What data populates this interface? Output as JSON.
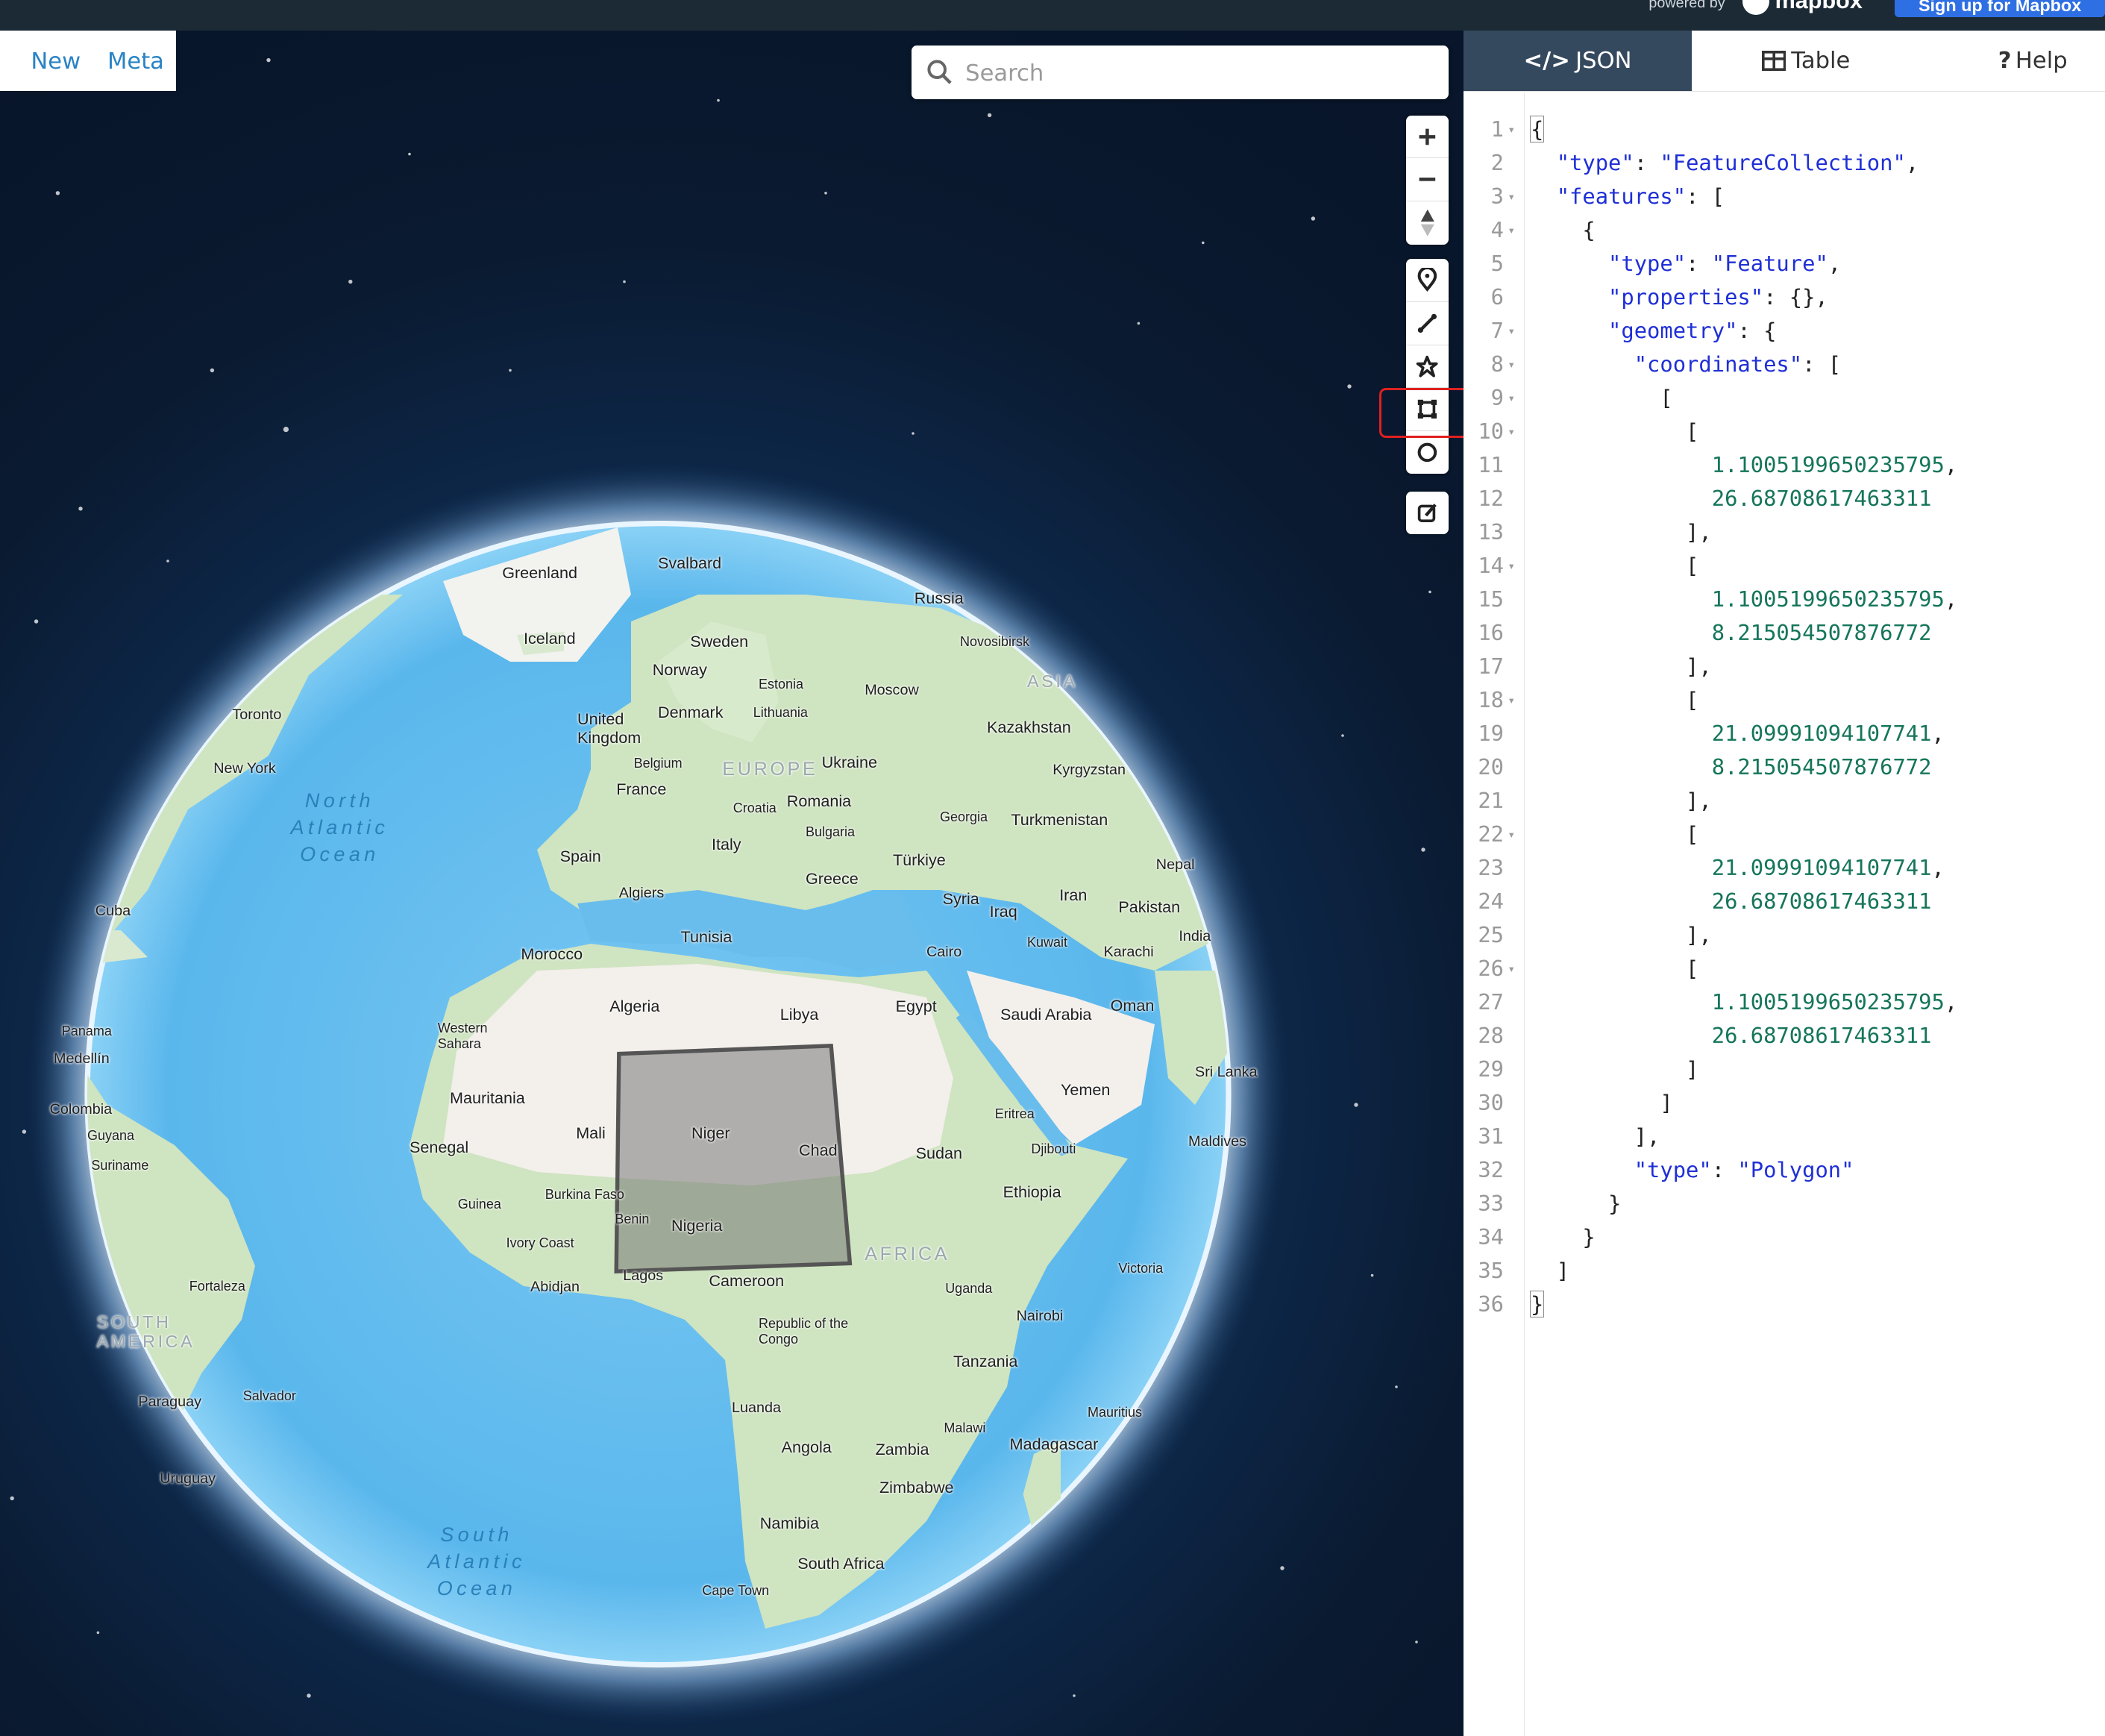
{
  "topbar": {
    "powered_by": "powered by",
    "mapbox": "mapbox",
    "signup": "Sign up for Mapbox"
  },
  "menu": {
    "new": "New",
    "meta": "Meta"
  },
  "search": {
    "placeholder": "Search"
  },
  "controls": [
    "plus-icon",
    "minus-icon",
    "compass-icon",
    "marker-icon",
    "line-icon",
    "polygon-icon",
    "rectangle-icon",
    "circle-icon",
    "edit-icon"
  ],
  "tabs": {
    "json": "JSON",
    "table": "Table",
    "help": "Help"
  },
  "map_labels": {
    "countries": [
      "Greenland",
      "Svalbard",
      "Russia",
      "Iceland",
      "Sweden",
      "Norway",
      "Estonia",
      "Moscow",
      "Novosibirsk",
      "ASIA",
      "Toronto",
      "New York",
      "United Kingdom",
      "Denmark",
      "Lithuania",
      "Kazakhstan",
      "Belgium",
      "EUROPE",
      "Ukraine",
      "Kyrgyzstan",
      "France",
      "Croatia",
      "Romania",
      "Georgia",
      "Turkmenistan",
      "Bulgaria",
      "Spain",
      "Italy",
      "Türkiye",
      "Nepal",
      "Greece",
      "Algiers",
      "Syria",
      "Iran",
      "Cuba",
      "Iraq",
      "Pakistan",
      "Tunisia",
      "Morocco",
      "Kuwait",
      "Karachi",
      "India",
      "Cairo",
      "Algeria",
      "Libya",
      "Egypt",
      "Saudi Arabia",
      "Oman",
      "Western Sahara",
      "Panama",
      "Medellín",
      "Sri Lanka",
      "Mauritania",
      "Yemen",
      "Colombia",
      "Eritrea",
      "Mali",
      "Niger",
      "Chad",
      "Sudan",
      "Maldives",
      "Guyana",
      "Senegal",
      "Djibouti",
      "Suriname",
      "Burkina Faso",
      "Ethiopia",
      "Guinea",
      "Benin",
      "Nigeria",
      "Ivory Coast",
      "AFRICA",
      "Abidjan",
      "Lagos",
      "Cameroon",
      "Victoria",
      "Fortaleza",
      "Uganda",
      "Nairobi",
      "SOUTH AMERICA",
      "Republic of the Congo",
      "Tanzania",
      "Paraguay",
      "Salvador",
      "Luanda",
      "Mauritius",
      "Malawi",
      "Angola",
      "Zambia",
      "Madagascar",
      "Uruguay",
      "Zimbabwe",
      "Namibia",
      "South Africa",
      "Cape Town"
    ],
    "ocean_north": "North Atlantic Ocean",
    "ocean_south": "South Atlantic Ocean"
  },
  "json_lines": [
    "{",
    "  \"type\": \"FeatureCollection\",",
    "  \"features\": [",
    "    {",
    "      \"type\": \"Feature\",",
    "      \"properties\": {},",
    "      \"geometry\": {",
    "        \"coordinates\": [",
    "          [",
    "            [",
    "              1.1005199650235795,",
    "              26.68708617463311",
    "            ],",
    "            [",
    "              1.1005199650235795,",
    "              8.215054507876772",
    "            ],",
    "            [",
    "              21.09991094107741,",
    "              8.215054507876772",
    "            ],",
    "            [",
    "              21.09991094107741,",
    "              26.68708617463311",
    "            ],",
    "            [",
    "              1.1005199650235795,",
    "              26.68708617463311",
    "            ]",
    "          ]",
    "        ],",
    "        \"type\": \"Polygon\"",
    "      }",
    "    }",
    "  ]",
    "}"
  ],
  "polygon_coordinates": [
    [
      1.1005199650235795,
      26.68708617463311
    ],
    [
      1.1005199650235795,
      8.215054507876772
    ],
    [
      21.09991094107741,
      8.215054507876772
    ],
    [
      21.09991094107741,
      26.68708617463311
    ],
    [
      1.1005199650235795,
      26.68708617463311
    ]
  ],
  "colors": {
    "accent": "#2f6fe4",
    "tab_active": "#34495e",
    "highlight": "#e02020",
    "ocean": "#5bb6ea",
    "land": "#cfe4c1"
  }
}
